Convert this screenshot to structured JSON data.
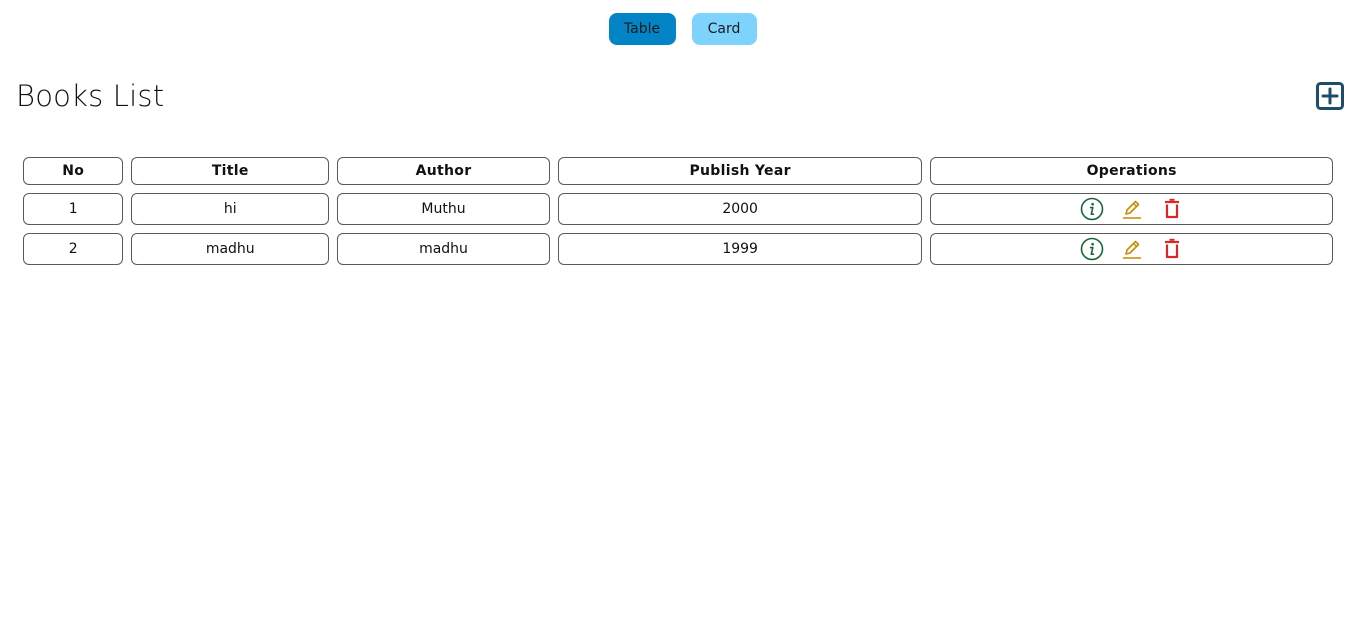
{
  "view_toggle": {
    "table_label": "Table",
    "card_label": "Card",
    "active": "Table"
  },
  "page": {
    "title": "Books List"
  },
  "table": {
    "headers": {
      "no": "No",
      "title": "Title",
      "author": "Author",
      "publish_year": "Publish Year",
      "operations": "Operations"
    },
    "rows": [
      {
        "no": "1",
        "title": "hi",
        "author": "Muthu",
        "publish_year": "2000"
      },
      {
        "no": "2",
        "title": "madhu",
        "author": "madhu",
        "publish_year": "1999"
      }
    ]
  },
  "icons": {
    "add": "add-square-icon",
    "info": "info-circle-icon",
    "edit": "pencil-edit-icon",
    "delete": "trash-icon"
  },
  "colors": {
    "table_button_active": "#0284c7",
    "card_button": "#7dd3fc",
    "add_icon": "#1e4d6b",
    "info_icon": "#166534",
    "edit_icon": "#ca8a04",
    "delete_icon": "#dc2626",
    "cell_border": "#5a5a5a"
  }
}
